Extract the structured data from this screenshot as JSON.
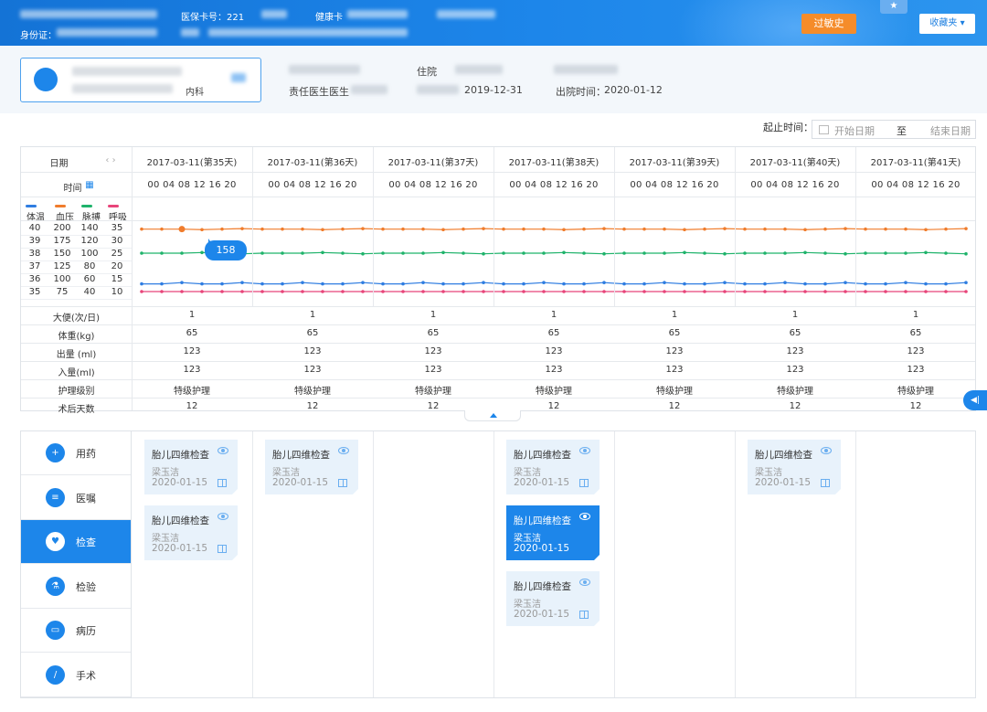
{
  "header": {
    "card_no_label": "医保卡号：221",
    "health_label": "健康卡",
    "id_label": "身份证：",
    "allergy_button": "过敏史",
    "favorites_button": "收藏夹 ▾"
  },
  "patient": {
    "dept": "内科",
    "bed_label": "住院",
    "doctor_label": "责任医生医生",
    "admit_date": "2019-12-31",
    "discharge_label": "出院时间：",
    "discharge_date": "2020-01-12"
  },
  "date_range": {
    "label": "起止时间：",
    "start_placeholder": "开始日期",
    "to": "至",
    "end_placeholder": "结束日期"
  },
  "vitals": {
    "date_label": "日期",
    "time_label": "时间",
    "hours": "00 04 08 12 16 20",
    "days": [
      "2017-03-11(第35天)",
      "2017-03-11(第36天)",
      "2017-03-11(第37天)",
      "2017-03-11(第38天)",
      "2017-03-11(第39天)",
      "2017-03-11(第40天)",
      "2017-03-11(第41天)"
    ],
    "legend": [
      {
        "name": "体温",
        "color": "#2f7de1"
      },
      {
        "name": "血压",
        "color": "#f07c2c"
      },
      {
        "name": "脉搏",
        "color": "#1fb36b"
      },
      {
        "name": "呼吸",
        "color": "#e8457a"
      }
    ],
    "scale_rows": [
      [
        "40",
        "200",
        "140",
        "35"
      ],
      [
        "39",
        "175",
        "120",
        "30"
      ],
      [
        "38",
        "150",
        "100",
        "25"
      ],
      [
        "37",
        "125",
        "80",
        "20"
      ],
      [
        "36",
        "100",
        "60",
        "15"
      ],
      [
        "35",
        "75",
        "40",
        "10"
      ]
    ],
    "tooltip": "158",
    "rows": [
      {
        "label": "大便(次/日)",
        "values": [
          "1",
          "1",
          "1",
          "1",
          "1",
          "1",
          "1"
        ]
      },
      {
        "label": "体重(kg)",
        "values": [
          "65",
          "65",
          "65",
          "65",
          "65",
          "65",
          "65"
        ]
      },
      {
        "label": "出量 (ml)",
        "values": [
          "123",
          "123",
          "123",
          "123",
          "123",
          "123",
          "123"
        ]
      },
      {
        "label": "入量(ml)",
        "values": [
          "123",
          "123",
          "123",
          "123",
          "123",
          "123",
          "123"
        ]
      },
      {
        "label": "护理级别",
        "values": [
          "特级护理",
          "特级护理",
          "特级护理",
          "特级护理",
          "特级护理",
          "特级护理",
          "特级护理"
        ]
      },
      {
        "label": "术后天数",
        "values": [
          "12",
          "12",
          "12",
          "12",
          "12",
          "12",
          "12"
        ]
      }
    ]
  },
  "chart_data": {
    "type": "line",
    "x": [
      "35-00",
      "35-04",
      "35-08",
      "35-12",
      "35-16",
      "35-20",
      "36-00",
      "36-04",
      "36-08",
      "36-12",
      "36-16",
      "36-20",
      "37-00",
      "37-04",
      "37-08",
      "37-12",
      "37-16",
      "37-20",
      "38-00",
      "38-04",
      "38-08",
      "38-12",
      "38-16",
      "38-20",
      "39-00",
      "39-04",
      "39-08",
      "39-12",
      "39-16",
      "39-20",
      "40-00",
      "40-04",
      "40-08",
      "40-12",
      "40-16",
      "40-20",
      "41-00",
      "41-04",
      "41-08",
      "41-12",
      "41-16",
      "41-20"
    ],
    "series": [
      {
        "name": "血压",
        "values": [
          197,
          197,
          197,
          196,
          197,
          198,
          197,
          197,
          197,
          196,
          197,
          198,
          197,
          197,
          197,
          196,
          197,
          198,
          197,
          197,
          197,
          196,
          197,
          198,
          197,
          197,
          197,
          196,
          197,
          198,
          197,
          197,
          197,
          196,
          197,
          198,
          197,
          197,
          197,
          196,
          197,
          198
        ]
      },
      {
        "name": "脉搏",
        "values": [
          100,
          100,
          100,
          101,
          100,
          99,
          100,
          100,
          100,
          101,
          100,
          99,
          100,
          100,
          100,
          101,
          100,
          99,
          100,
          100,
          100,
          101,
          100,
          99,
          100,
          100,
          100,
          101,
          100,
          99,
          100,
          100,
          100,
          101,
          100,
          99,
          100,
          100,
          100,
          101,
          100,
          99
        ]
      },
      {
        "name": "体温",
        "values": [
          35.6,
          35.6,
          35.7,
          35.6,
          35.6,
          35.7,
          35.6,
          35.6,
          35.7,
          35.6,
          35.6,
          35.7,
          35.6,
          35.6,
          35.7,
          35.6,
          35.6,
          35.7,
          35.6,
          35.6,
          35.7,
          35.6,
          35.6,
          35.7,
          35.6,
          35.6,
          35.7,
          35.6,
          35.6,
          35.7,
          35.6,
          35.6,
          35.7,
          35.6,
          35.6,
          35.7,
          35.6,
          35.6,
          35.7,
          35.6,
          35.6,
          35.7
        ]
      },
      {
        "name": "呼吸",
        "values": [
          10,
          10,
          10,
          10,
          10,
          10,
          10,
          10,
          10,
          10,
          10,
          10,
          10,
          10,
          10,
          10,
          10,
          10,
          10,
          10,
          10,
          10,
          10,
          10,
          10,
          10,
          10,
          10,
          10,
          10,
          10,
          10,
          10,
          10,
          10,
          10,
          10,
          10,
          10,
          10,
          10,
          10
        ]
      }
    ]
  },
  "nav": [
    {
      "label": "用药",
      "icon": "medicine-icon",
      "glyph": "+"
    },
    {
      "label": "医嘱",
      "icon": "order-icon",
      "glyph": "≡"
    },
    {
      "label": "检查",
      "icon": "heart-check-icon",
      "glyph": "♥"
    },
    {
      "label": "检验",
      "icon": "flask-icon",
      "glyph": "⚗"
    },
    {
      "label": "病历",
      "icon": "folder-icon",
      "glyph": "▭"
    },
    {
      "label": "手术",
      "icon": "scalpel-icon",
      "glyph": "/"
    }
  ],
  "exam_cards": [
    {
      "title": "胎儿四维检查",
      "doctor": "梁玉洁",
      "date": "2020-01-15"
    },
    {
      "title": "胎儿四维检查",
      "doctor": "梁玉洁",
      "date": "2020-01-15"
    },
    {
      "title": "胎儿四维检查",
      "doctor": "梁玉洁",
      "date": "2020-01-15"
    },
    {
      "title": "胎儿四维检查",
      "doctor": "梁玉洁",
      "date": "2020-01-15"
    },
    {
      "title": "胎儿四维检查",
      "doctor": "梁玉洁",
      "date": "2020-01-15"
    },
    {
      "title": "胎儿四维检查",
      "doctor": "梁玉洁",
      "date": "2020-01-15"
    },
    {
      "title": "胎儿四维检查",
      "doctor": "梁玉洁",
      "date": "2020-01-15"
    }
  ]
}
